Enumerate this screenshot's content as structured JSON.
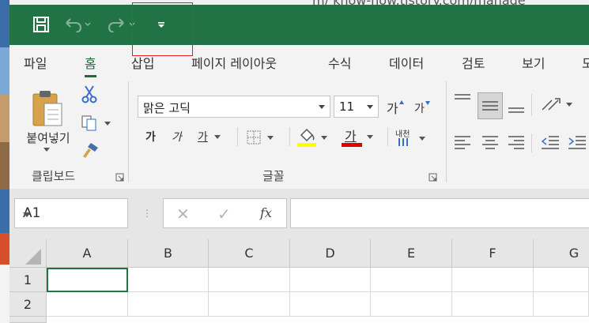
{
  "background": {
    "url_fragment": "m/   know-how.tistory.com/manage"
  },
  "quick_access": {
    "save_icon": "save-icon",
    "undo_icon": "undo-icon",
    "redo_icon": "redo-icon",
    "customize_icon": "customize-qat-icon"
  },
  "tabs": [
    "파일",
    "홈",
    "삽입",
    "페이지 레이아웃",
    "수식",
    "데이터",
    "검토",
    "보기",
    "도"
  ],
  "ribbon": {
    "clipboard": {
      "paste_label": "붙여넣기",
      "group_label": "클립보드"
    },
    "font": {
      "font_name": "맑은 고딕",
      "font_size": "11",
      "grow_label": "가",
      "shrink_label": "가",
      "bold_label": "가",
      "italic_label": "가",
      "underline_label": "가",
      "font_color_label": "가",
      "phonetic_label": "내천",
      "group_label": "글꼴",
      "fill_color": "#ffff00",
      "font_color": "#e00000"
    }
  },
  "formula_bar": {
    "name_box": "A1",
    "cancel_label": "✕",
    "enter_label": "✓",
    "fx_label": "fx",
    "formula": ""
  },
  "grid": {
    "columns": [
      "A",
      "B",
      "C",
      "D",
      "E",
      "F",
      "G"
    ],
    "rows": [
      "1",
      "2"
    ]
  },
  "colors": {
    "title_bar": "#217346",
    "active_tab": "#1e6b3f",
    "highlight_box": "#e02020"
  }
}
